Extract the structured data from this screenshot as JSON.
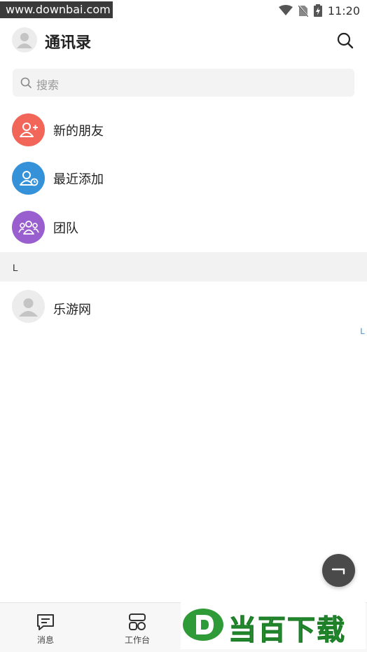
{
  "status_bar": {
    "watermark": "www.downbai.com",
    "time": "11:20"
  },
  "header": {
    "title": "通讯录"
  },
  "search": {
    "placeholder": "搜索"
  },
  "entries": [
    {
      "label": "新的朋友",
      "icon": "add-user-icon",
      "color": "#f2665a"
    },
    {
      "label": "最近添加",
      "icon": "recent-user-icon",
      "color": "#3592d9"
    },
    {
      "label": "团队",
      "icon": "team-icon",
      "color": "#9a5fce"
    }
  ],
  "section": {
    "letter": "L"
  },
  "contacts": [
    {
      "name": "乐游网",
      "icon": "default-avatar-icon"
    }
  ],
  "index_bar": {
    "letter": "L"
  },
  "tabs": [
    {
      "label": "消息",
      "icon": "message-icon"
    },
    {
      "label": "工作台",
      "icon": "workbench-icon"
    }
  ],
  "banner": {
    "text": "当百下载",
    "color": "#2e9a38"
  }
}
